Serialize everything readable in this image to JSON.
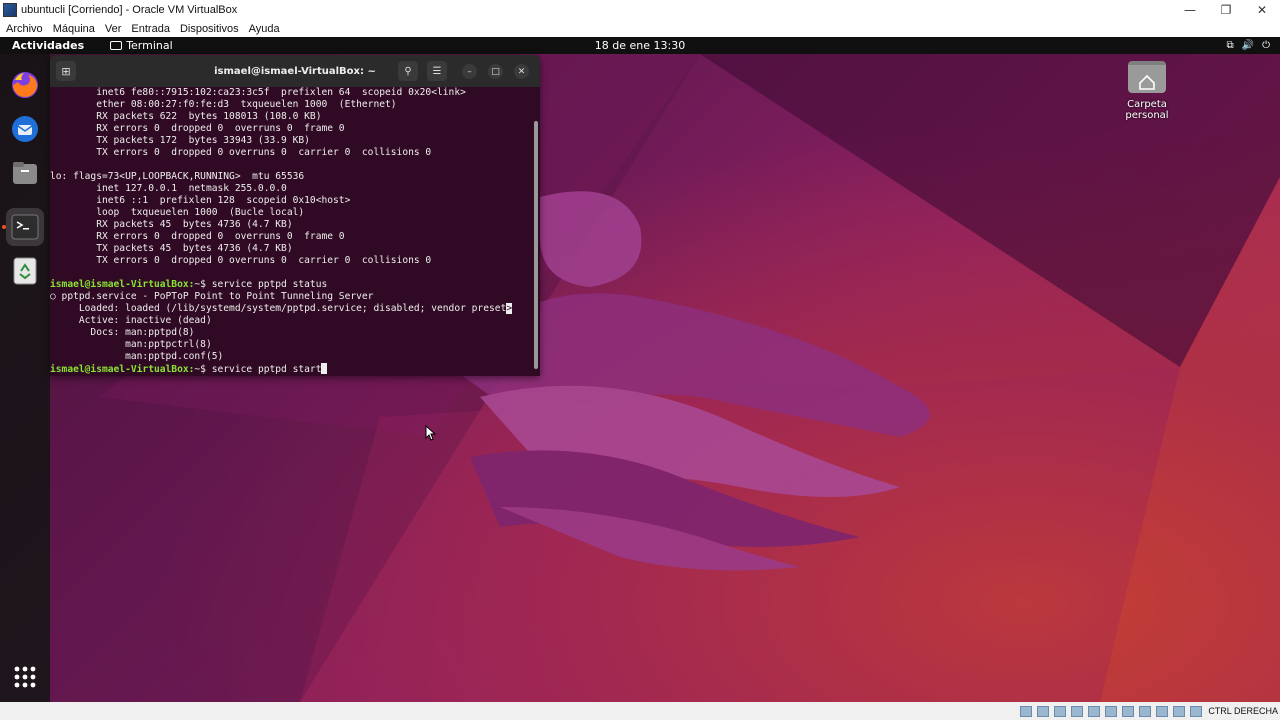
{
  "vbox": {
    "title": "ubuntucli [Corriendo] - Oracle VM VirtualBox",
    "menu": [
      "Archivo",
      "Máquina",
      "Ver",
      "Entrada",
      "Dispositivos",
      "Ayuda"
    ],
    "host_key": "CTRL DERECHA"
  },
  "topbar": {
    "activities": "Actividades",
    "app": "Terminal",
    "clock": "18 de ene  13:30"
  },
  "dock": [
    "firefox-icon",
    "thunderbird-icon",
    "files-icon",
    "terminal-icon",
    "trash-icon",
    "app-grid-icon"
  ],
  "desktop": {
    "home_folder": "Carpeta personal"
  },
  "terminal": {
    "title": "ismael@ismael-VirtualBox: ~",
    "lines": [
      {
        "t": "        inet6 fe80::7915:102:ca23:3c5f  prefixlen 64  scopeid 0x20<link>"
      },
      {
        "t": "        ether 08:00:27:f0:fe:d3  txqueuelen 1000  (Ethernet)"
      },
      {
        "t": "        RX packets 622  bytes 108013 (108.0 KB)"
      },
      {
        "t": "        RX errors 0  dropped 0  overruns 0  frame 0"
      },
      {
        "t": "        TX packets 172  bytes 33943 (33.9 KB)"
      },
      {
        "t": "        TX errors 0  dropped 0 overruns 0  carrier 0  collisions 0"
      },
      {
        "t": ""
      },
      {
        "t": "lo: flags=73<UP,LOOPBACK,RUNNING>  mtu 65536"
      },
      {
        "t": "        inet 127.0.0.1  netmask 255.0.0.0"
      },
      {
        "t": "        inet6 ::1  prefixlen 128  scopeid 0x10<host>"
      },
      {
        "t": "        loop  txqueuelen 1000  (Bucle local)"
      },
      {
        "t": "        RX packets 45  bytes 4736 (4.7 KB)"
      },
      {
        "t": "        RX errors 0  dropped 0  overruns 0  frame 0"
      },
      {
        "t": "        TX packets 45  bytes 4736 (4.7 KB)"
      },
      {
        "t": "        TX errors 0  dropped 0 overruns 0  carrier 0  collisions 0"
      },
      {
        "t": ""
      },
      {
        "p": "ismael@ismael-VirtualBox:",
        "t": "~$ service pptpd status"
      },
      {
        "t": "○ pptpd.service - PoPToP Point to Point Tunneling Server"
      },
      {
        "t": "     Loaded: loaded (/lib/systemd/system/pptpd.service; disabled; vendor preset",
        "inv": ">"
      },
      {
        "t": "     Active: inactive (dead)"
      },
      {
        "t": "       Docs: man:pptpd(8)"
      },
      {
        "t": "             man:pptpctrl(8)"
      },
      {
        "t": "             man:pptpd.conf(5)"
      },
      {
        "p": "ismael@ismael-VirtualBox:",
        "t": "~$ service pptpd start",
        "cursor": true
      }
    ]
  }
}
